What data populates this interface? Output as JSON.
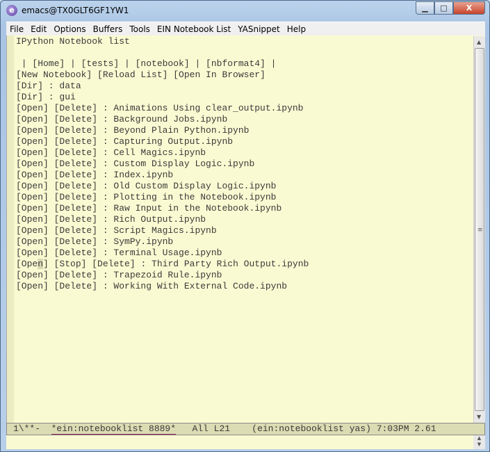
{
  "window": {
    "title": "emacs@TX0GLT6GF1YW1",
    "minimize": "▁",
    "maximize": "□",
    "close": "X"
  },
  "menu": [
    "File",
    "Edit",
    "Options",
    "Buffers",
    "Tools",
    "EIN Notebook List",
    "YASnippet",
    "Help"
  ],
  "buffer": {
    "heading": "IPython Notebook list",
    "nav": " | [Home] | [tests] | [notebook] | [nbformat4] |",
    "actions": "[New Notebook] [Reload List] [Open In Browser]",
    "dirs": [
      "[Dir] : data",
      "[Dir] : gui"
    ],
    "notebooks": [
      "[Open] [Delete] : Animations Using clear_output.ipynb",
      "[Open] [Delete] : Background Jobs.ipynb",
      "[Open] [Delete] : Beyond Plain Python.ipynb",
      "[Open] [Delete] : Capturing Output.ipynb",
      "[Open] [Delete] : Cell Magics.ipynb",
      "[Open] [Delete] : Custom Display Logic.ipynb",
      "[Open] [Delete] : Index.ipynb",
      "[Open] [Delete] : Old Custom Display Logic.ipynb",
      "[Open] [Delete] : Plotting in the Notebook.ipynb",
      "[Open] [Delete] : Raw Input in the Notebook.ipynb",
      "[Open] [Delete] : Rich Output.ipynb",
      "[Open] [Delete] : Script Magics.ipynb",
      "[Open] [Delete] : SymPy.ipynb",
      "[Open] [Delete] : Terminal Usage.ipynb"
    ],
    "cursor_line": {
      "before": "[Ope",
      "cursor": "n",
      "after": "] [Stop] [Delete] : Third Party Rich Output.ipynb"
    },
    "notebooks_after": [
      "[Open] [Delete] : Trapezoid Rule.ipynb",
      "[Open] [Delete] : Working With External Code.ipynb"
    ]
  },
  "modeline": {
    "prefix": "1\\**-  ",
    "buffer_name": "*ein:notebooklist 8889*",
    "rest": "   All L21    (ein:notebooklist yas) 7:03PM 2.61"
  }
}
